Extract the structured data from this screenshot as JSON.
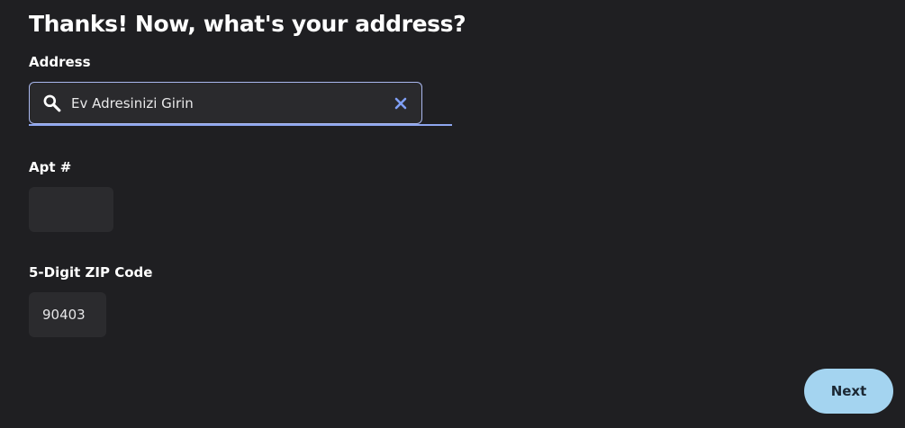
{
  "page": {
    "title": "Thanks! Now, what's your address?"
  },
  "address": {
    "label": "Address",
    "placeholder": "Ev Adresinizi Girin",
    "value": "",
    "search_icon": "search-icon",
    "clear_icon": "close-icon"
  },
  "apt": {
    "label": "Apt #",
    "value": ""
  },
  "zip": {
    "label": "5-Digit ZIP Code",
    "value": "90403"
  },
  "actions": {
    "next_label": "Next"
  },
  "colors": {
    "background": "#1f1f22",
    "field_background": "#2b2b2e",
    "focus_border": "#a9b7ee",
    "underline": "#8ea6ef",
    "clear_icon": "#7f9ff5",
    "next_button": "#a4d4f0"
  }
}
